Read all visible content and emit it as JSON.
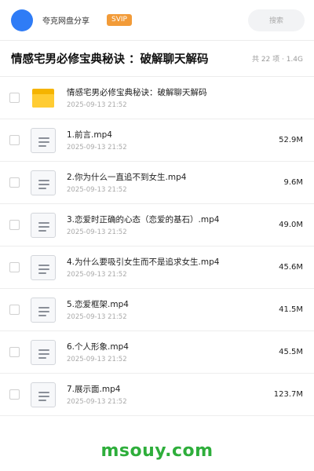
{
  "header": {
    "share_title": "夸克网盘分享",
    "badge": "SVIP",
    "search_placeholder": "搜索"
  },
  "title_row": {
    "title": "情感宅男必修宝典秘诀 ：破解聊天解码",
    "meta": "共 22 项 · 1.4G"
  },
  "files": [
    {
      "name": "情感宅男必修宝典秘诀：破解聊天解码",
      "date": "2025-09-13 21:52",
      "size": "",
      "type": "folder"
    },
    {
      "name": "1.前言.mp4",
      "date": "2025-09-13 21:52",
      "size": "52.9M",
      "type": "file"
    },
    {
      "name": "2.你为什么一直追不到女生.mp4",
      "date": "2025-09-13 21:52",
      "size": "9.6M",
      "type": "file"
    },
    {
      "name": "3.恋爱时正确的心态（恋爱的基石）.mp4",
      "date": "2025-09-13 21:52",
      "size": "49.0M",
      "type": "file"
    },
    {
      "name": "4.为什么要吸引女生而不是追求女生.mp4",
      "date": "2025-09-13 21:52",
      "size": "45.6M",
      "type": "file"
    },
    {
      "name": "5.恋爱框架.mp4",
      "date": "2025-09-13 21:52",
      "size": "41.5M",
      "type": "file"
    },
    {
      "name": "6.个人形象.mp4",
      "date": "2025-09-13 21:52",
      "size": "45.5M",
      "type": "file"
    },
    {
      "name": "7.展示面.mp4",
      "date": "2025-09-13 21:52",
      "size": "123.7M",
      "type": "file"
    }
  ],
  "watermark": "msouy.com",
  "colors": {
    "accent": "#2f7cf6",
    "svip": "#f29b38",
    "folder": "#ffcc33",
    "watermark": "#2eae3b"
  }
}
